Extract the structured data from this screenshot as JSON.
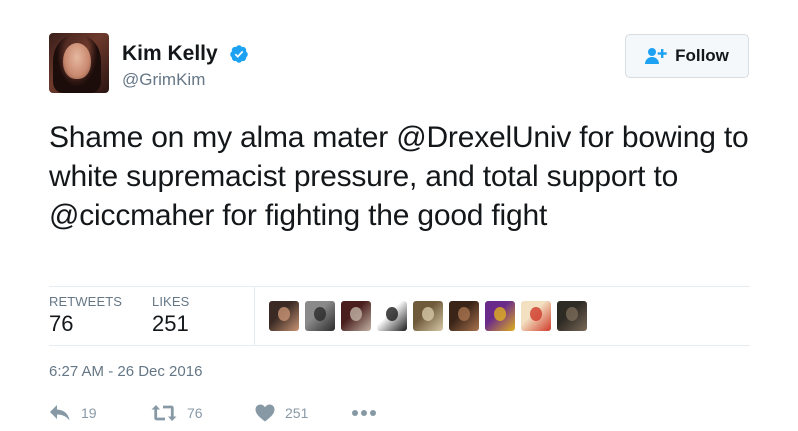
{
  "author": {
    "display_name": "Kim Kelly",
    "handle": "@GrimKim",
    "verified": true
  },
  "follow_button": {
    "label": "Follow"
  },
  "tweet": {
    "segments": [
      {
        "type": "text",
        "value": "Shame on my alma mater "
      },
      {
        "type": "mention",
        "value": "@DrexelUniv"
      },
      {
        "type": "text",
        "value": " for bowing to white supremacist pressure, and total support to "
      },
      {
        "type": "mention",
        "value": "@ciccmaher"
      },
      {
        "type": "text",
        "value": " for fighting the good fight"
      }
    ]
  },
  "stats": {
    "retweets_label": "RETWEETS",
    "retweets_value": "76",
    "likes_label": "LIKES",
    "likes_value": "251"
  },
  "likers": [
    {
      "name": "liker-avatar-1",
      "colors": [
        "#3b2a24",
        "#c89474"
      ]
    },
    {
      "name": "liker-avatar-2",
      "colors": [
        "#8a8a8a",
        "#2b2b2b"
      ]
    },
    {
      "name": "liker-avatar-3",
      "colors": [
        "#4a1e1c",
        "#c2b3a6"
      ]
    },
    {
      "name": "liker-avatar-4",
      "colors": [
        "#ffffff",
        "#1a1a1a"
      ]
    },
    {
      "name": "liker-avatar-5",
      "colors": [
        "#6f5a3a",
        "#d6c9a8"
      ]
    },
    {
      "name": "liker-avatar-6",
      "colors": [
        "#3a2418",
        "#a8734e"
      ]
    },
    {
      "name": "liker-avatar-7",
      "colors": [
        "#6a2a8a",
        "#e0b020"
      ]
    },
    {
      "name": "liker-avatar-8",
      "colors": [
        "#f2e0c0",
        "#d03a2a"
      ]
    },
    {
      "name": "liker-avatar-9",
      "colors": [
        "#2e2a24",
        "#7a6a58"
      ]
    }
  ],
  "timestamp": "6:27 AM - 26 Dec 2016",
  "actions": {
    "reply_count": "19",
    "retweet_count": "76",
    "like_count": "251",
    "more_label": "•••"
  },
  "colors": {
    "text": "#14171a",
    "secondary": "#657786",
    "icon": "#8899a6",
    "verified": "#1da1f2",
    "follow_icon": "#1da1f2"
  }
}
